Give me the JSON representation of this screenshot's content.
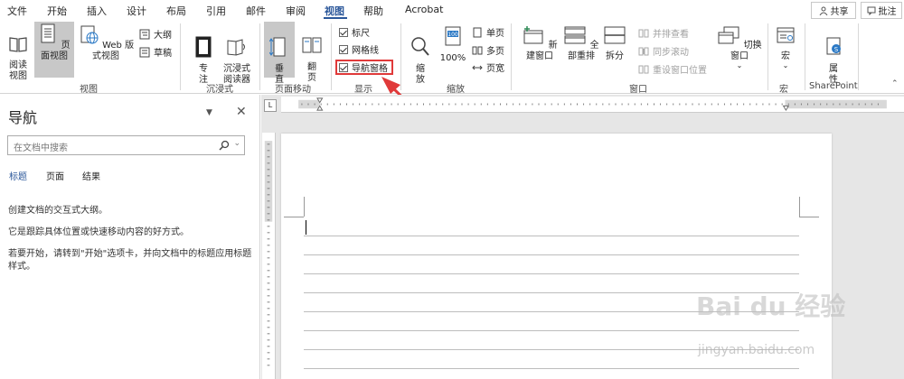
{
  "tabs": [
    "文件",
    "开始",
    "插入",
    "设计",
    "布局",
    "引用",
    "邮件",
    "审阅",
    "视图",
    "帮助",
    "Acrobat"
  ],
  "active_tab": "视图",
  "share_label": "共享",
  "comment_label": "批注",
  "views": {
    "read_mode": "阅读\n视图",
    "print_layout": "页面视图",
    "web_layout": "Web 版式视图",
    "outline": "大纲",
    "draft": "草稿",
    "group_label": "视图"
  },
  "immersive": {
    "focus": "专\n注",
    "reader": "沉浸式\n阅读器",
    "group_label": "沉浸式"
  },
  "page_movement": {
    "vertical": "垂\n直",
    "side_to_side": "翻\n页",
    "group_label": "页面移动"
  },
  "show": {
    "ruler": "标尺",
    "gridlines": "网格线",
    "nav_pane": "导航窗格",
    "group_label": "显示"
  },
  "zoom": {
    "zoom": "缩\n放",
    "percent": "100%",
    "one_page": "单页",
    "multi_page": "多页",
    "page_width": "页宽",
    "group_label": "缩放"
  },
  "window": {
    "new_window": "新建窗口",
    "arrange_all": "全部重排",
    "split": "拆分",
    "side_by_side": "并排查看",
    "sync_scroll": "同步滚动",
    "reset_position": "重设窗口位置",
    "switch_window": "切换窗口",
    "group_label": "窗口"
  },
  "macros": {
    "label": "宏",
    "group_label": "宏"
  },
  "sharepoint": {
    "label": "属\n性",
    "group_label": "SharePoint"
  },
  "nav_pane": {
    "title": "导航",
    "search_placeholder": "在文档中搜索",
    "tabs": [
      "标题",
      "页面",
      "结果"
    ],
    "line1": "创建文档的交互式大纲。",
    "line2": "它是跟踪具体位置或快速移动内容的好方式。",
    "line3": "若要开始，请转到\"开始\"选项卡，并向文档中的标题应用标题样式。"
  },
  "watermark": {
    "brand": "Bai du 经验",
    "url": "jingyan.baidu.com"
  },
  "colors": {
    "accent": "#2b579a",
    "highlight": "#e03a3a"
  }
}
